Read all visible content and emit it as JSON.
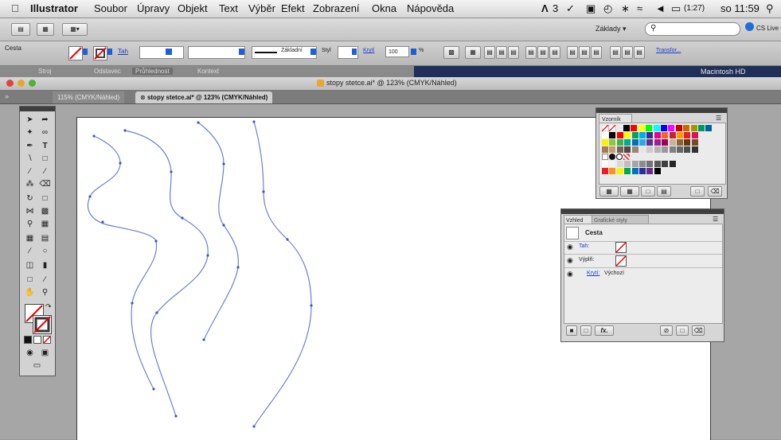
{
  "menubar": {
    "app_name": "Illustrator",
    "items": [
      "Soubor",
      "Úpravy",
      "Objekt",
      "Text",
      "Výběr",
      "Efekt",
      "Zobrazení",
      "Okna",
      "Nápověda"
    ],
    "status_ai": "3",
    "battery": "(1:27)",
    "clock": "so 11:59"
  },
  "appbar": {
    "workspace": "Základy ▾",
    "search_placeholder": "",
    "cs_live": "CS Live ▾"
  },
  "controlbar": {
    "selection_label": "Cesta",
    "stroke_label": "Tah",
    "brush_label": "Základní",
    "style_label": "Styl",
    "opacity_label": "Krytí",
    "opacity_value": "100",
    "opacity_unit": "%",
    "transform_label": "Transfor..."
  },
  "tabstrip": {
    "items": [
      "Stroj",
      "Odstavec",
      "Průhlednost",
      "Kontext"
    ],
    "right_text": "Macintosh HD"
  },
  "document": {
    "title": "stopy stetce.ai* @ 123% (CMYK/Náhled)",
    "tabs": [
      {
        "label": "115% (CMYK/Náhled)"
      },
      {
        "label": "stopy stetce.ai* @ 123% (CMYK/Náhled)"
      }
    ]
  },
  "swatches_panel": {
    "title": "Vzorník",
    "colors": {
      "row2": [
        "#ffffff",
        "#000000",
        "#ff0000",
        "#ffff00",
        "#00a651",
        "#00aeef",
        "#2e3192",
        "#ec008c",
        "#f26522",
        "#c1272d",
        "#ff9900",
        "#ed1c24",
        "#d4145a"
      ],
      "row3": [
        "#fff200",
        "#8dc63f",
        "#39b54a",
        "#00a99d",
        "#0072bc",
        "#29abe2",
        "#662d91",
        "#92278f",
        "#9e005d",
        "#c2b59b",
        "#8c6239",
        "#603913",
        "#754c24"
      ],
      "row4": [
        "#a67c52",
        "#c69c6d",
        "#736357",
        "#534741",
        "#998675",
        "#e6e6e6",
        "#cccccc",
        "#b3b3b3",
        "#999999",
        "#808080",
        "#666666",
        "#4d4d4d",
        "#333333"
      ],
      "row6": [
        "#ffffff",
        "#f2f2f2",
        "#d9d9d9",
        "#bfbfbf",
        "#a6a6a6",
        "#8c8c8c",
        "#737373",
        "#595959",
        "#404040",
        "#262626"
      ],
      "row7": [
        "#ed1c24",
        "#f7941d",
        "#fff200",
        "#00a651",
        "#0072bc",
        "#2e3192",
        "#662d91",
        "#000000"
      ]
    }
  },
  "appearance_panel": {
    "tabs": [
      "Vzhled",
      "Grafické styly"
    ],
    "object": "Cesta",
    "stroke": "Tah:",
    "fill": "Výplň:",
    "opacity_label": "Krytí:",
    "opacity_value": "Výchozí",
    "fx_label": "fx."
  }
}
